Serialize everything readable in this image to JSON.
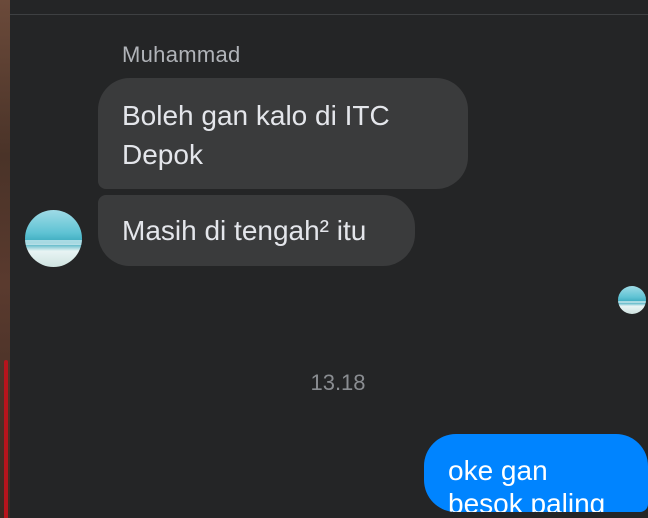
{
  "conversation": {
    "sender_name": "Muhammad",
    "messages_in": [
      {
        "text": "Boleh gan kalo di ITC\nDepok"
      },
      {
        "text": "Masih di tengah² itu"
      }
    ],
    "timestamp": "13.18",
    "message_out": {
      "text": "oke gan\nbesok paling"
    }
  },
  "colors": {
    "background": "#242526",
    "incoming_bubble": "#3a3b3c",
    "outgoing_bubble": "#0084ff",
    "incoming_text": "#e4e6eb",
    "meta_text": "#b0b3b8"
  }
}
